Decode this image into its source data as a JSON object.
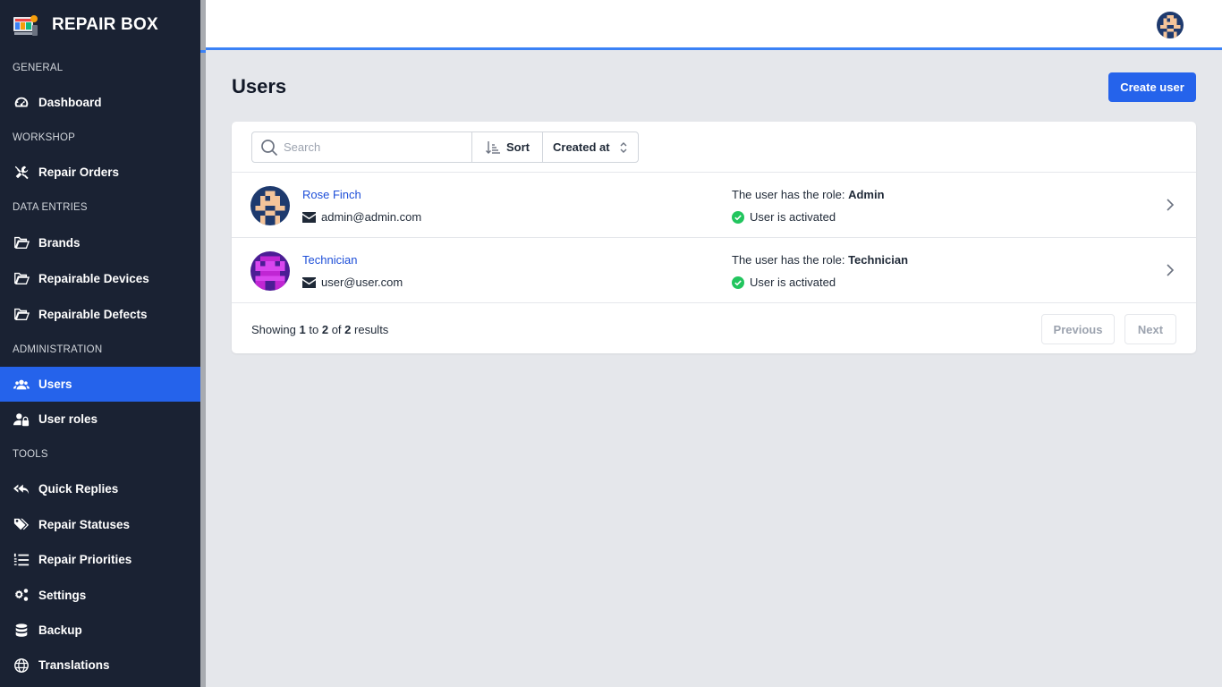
{
  "app": {
    "name": "REPAIR BOX",
    "logo_icon": "repair-box-logo-icon"
  },
  "sidebar": {
    "sections": [
      {
        "label": "GENERAL",
        "items": [
          {
            "label": "Dashboard",
            "icon": "gauge-icon"
          }
        ]
      },
      {
        "label": "WORKSHOP",
        "items": [
          {
            "label": "Repair Orders",
            "icon": "tools-icon"
          }
        ]
      },
      {
        "label": "DATA ENTRIES",
        "items": [
          {
            "label": "Brands",
            "icon": "folder-open-icon"
          },
          {
            "label": "Repairable Devices",
            "icon": "folder-open-icon"
          },
          {
            "label": "Repairable Defects",
            "icon": "folder-open-icon"
          }
        ]
      },
      {
        "label": "ADMINISTRATION",
        "items": [
          {
            "label": "Users",
            "icon": "users-icon",
            "active": true
          },
          {
            "label": "User roles",
            "icon": "user-lock-icon"
          }
        ]
      },
      {
        "label": "TOOLS",
        "items": [
          {
            "label": "Quick Replies",
            "icon": "reply-all-icon"
          },
          {
            "label": "Repair Statuses",
            "icon": "tags-icon"
          },
          {
            "label": "Repair Priorities",
            "icon": "list-ol-icon"
          },
          {
            "label": "Settings",
            "icon": "cogs-icon"
          },
          {
            "label": "Backup",
            "icon": "database-icon"
          },
          {
            "label": "Translations",
            "icon": "globe-icon"
          }
        ]
      }
    ],
    "active_color": "#2563eb"
  },
  "page": {
    "title": "Users",
    "create_button": "Create user"
  },
  "toolbar": {
    "search_placeholder": "Search",
    "sort_label": "Sort",
    "sort_field": "Created at"
  },
  "users": [
    {
      "name": "Rose Finch",
      "email": "admin@admin.com",
      "role_prefix": "The user has the role: ",
      "role": "Admin",
      "status": "User is activated"
    },
    {
      "name": "Technician",
      "email": "user@user.com",
      "role_prefix": "The user has the role: ",
      "role": "Technician",
      "status": "User is activated"
    }
  ],
  "pagination": {
    "showing": "Showing",
    "from": "1",
    "to_word": "to",
    "to": "2",
    "of_word": "of",
    "total": "2",
    "results": "results",
    "previous": "Previous",
    "next": "Next"
  },
  "colors": {
    "sidebar_bg": "#1a2233",
    "accent": "#2563eb",
    "link": "#1d4ed8",
    "success": "#22c55e"
  }
}
